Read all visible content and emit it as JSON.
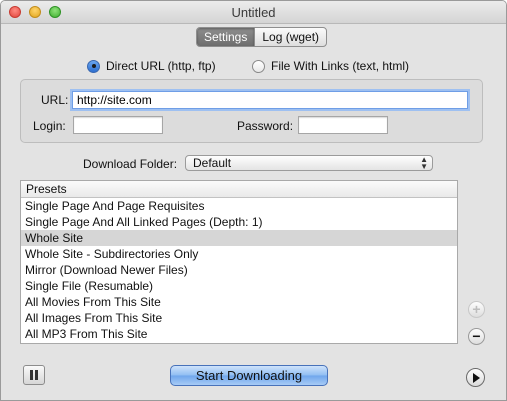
{
  "window": {
    "title": "Untitled"
  },
  "tabs": [
    {
      "label": "Settings",
      "active": true
    },
    {
      "label": "Log (wget)",
      "active": false
    }
  ],
  "source": {
    "options": [
      {
        "label": "Direct URL (http, ftp)",
        "selected": true
      },
      {
        "label": "File With Links (text, html)",
        "selected": false
      }
    ]
  },
  "form": {
    "url_label": "URL:",
    "url_value": "http://site.com",
    "login_label": "Login:",
    "login_value": "",
    "password_label": "Password:",
    "password_value": ""
  },
  "download_folder": {
    "label": "Download Folder:",
    "selected": "Default"
  },
  "presets": {
    "header": "Presets",
    "items": [
      "Single Page And Page Requisites",
      "Single Page And All Linked Pages (Depth: 1)",
      "Whole Site",
      "Whole Site - Subdirectories Only",
      "Mirror (Download Newer Files)",
      "Single File (Resumable)",
      "All Movies From This Site",
      "All Images From This Site",
      "All MP3 From This Site"
    ],
    "selected_index": 2
  },
  "controls": {
    "add_symbol": "+",
    "remove_symbol": "−",
    "start_label": "Start Downloading",
    "pause_icon": "pause-icon",
    "play_icon": "play-icon"
  }
}
